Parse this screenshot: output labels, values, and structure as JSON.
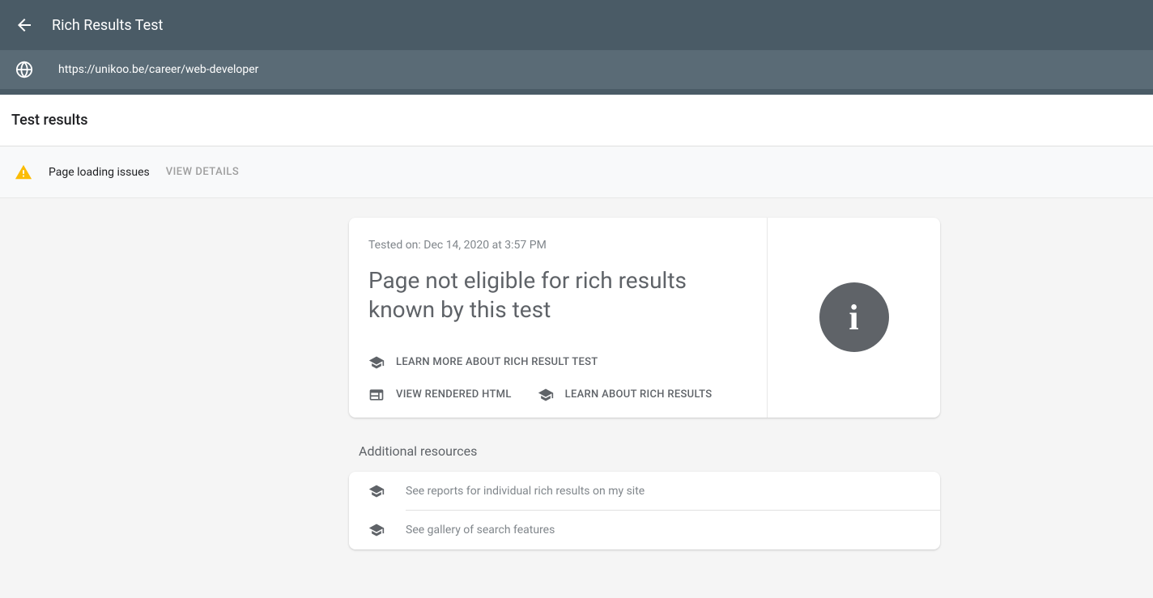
{
  "header": {
    "title": "Rich Results Test",
    "url": "https://unikoo.be/career/web-developer"
  },
  "results": {
    "title": "Test results",
    "issues_text": "Page loading issues",
    "view_details": "View details"
  },
  "card": {
    "tested_on": "Tested on: Dec 14, 2020 at 3:57 PM",
    "heading": "Page not eligible for rich results known by this test",
    "link_learn_test": "Learn more about Rich Result Test",
    "link_view_html": "View rendered HTML",
    "link_learn_results": "Learn about rich results"
  },
  "additional": {
    "title": "Additional resources",
    "items": [
      "See reports for individual rich results on my site",
      "See gallery of search features"
    ]
  }
}
